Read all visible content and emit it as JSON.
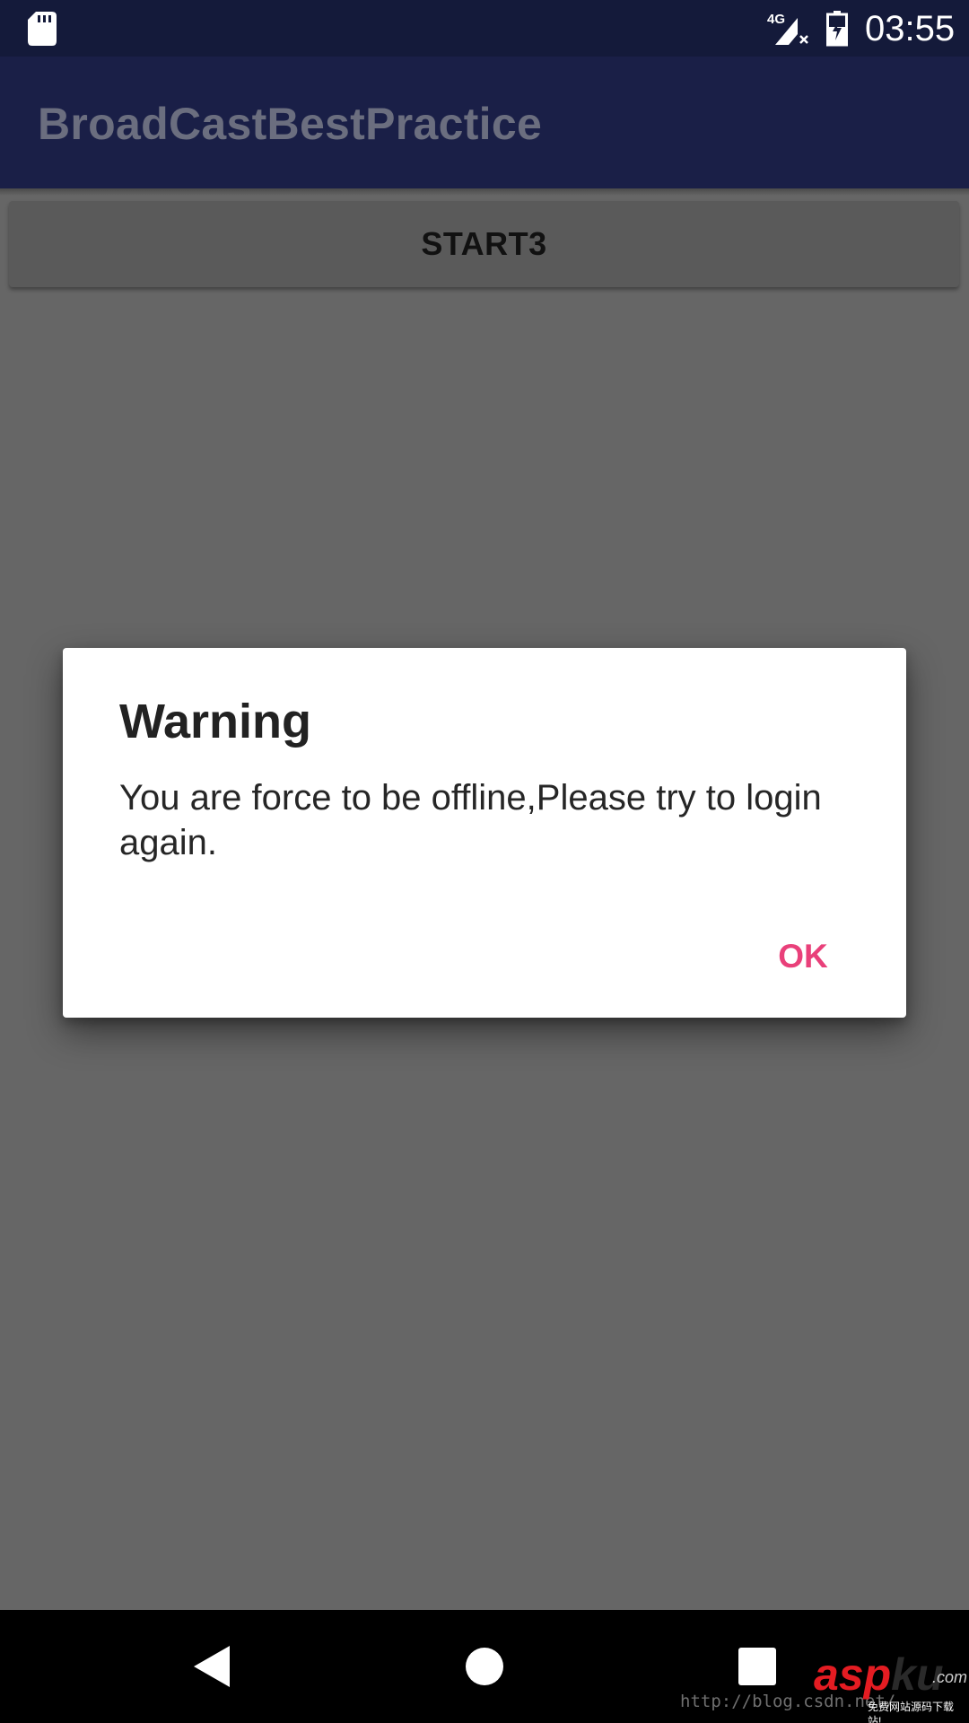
{
  "status_bar": {
    "network_label": "4G",
    "time": "03:55",
    "icons": [
      "sd-card-icon",
      "signal-no-sim-icon",
      "battery-charging-icon"
    ]
  },
  "app_bar": {
    "title": "BroadCastBestPractice"
  },
  "main": {
    "start_button_label": "START3"
  },
  "dialog": {
    "title": "Warning",
    "message": "You are force to be offline,Please try to login again.",
    "ok_label": "OK"
  },
  "nav_bar": {
    "icons": [
      "back-icon",
      "home-icon",
      "recents-icon"
    ]
  },
  "watermark": {
    "url": "http://blog.csdn.net/",
    "brand_a": "asp",
    "brand_b": "ku",
    "tld": ".com",
    "slogan": "免费网站源码下载站!"
  },
  "colors": {
    "status_bar_bg": "#141a3a",
    "app_bar_bg": "#1a1f47",
    "scrim_bg": "#666666",
    "accent": "#e9407a",
    "dialog_bg": "#ffffff"
  }
}
